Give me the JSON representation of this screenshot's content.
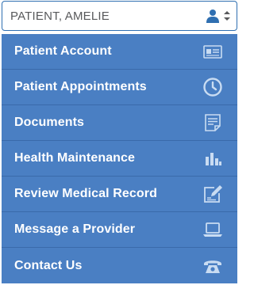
{
  "patient_selector": {
    "name": "PATIENT, AMELIE",
    "user_icon": "user-icon",
    "dropdown_icon": "sort-caret-icon"
  },
  "menu": {
    "items": [
      {
        "label": "Patient Account",
        "icon": "id-card-icon"
      },
      {
        "label": "Patient Appointments",
        "icon": "clock-icon"
      },
      {
        "label": "Documents",
        "icon": "document-icon"
      },
      {
        "label": "Health Maintenance",
        "icon": "bar-chart-icon"
      },
      {
        "label": "Review Medical Record",
        "icon": "edit-record-icon"
      },
      {
        "label": "Message a Provider",
        "icon": "laptop-icon"
      },
      {
        "label": "Contact Us",
        "icon": "telephone-icon"
      }
    ]
  },
  "colors": {
    "menu_background": "#4a7fc3",
    "menu_divider": "#3a6aaa",
    "selector_border": "#2f6fb1",
    "icon_color": "#c9dcf2"
  }
}
